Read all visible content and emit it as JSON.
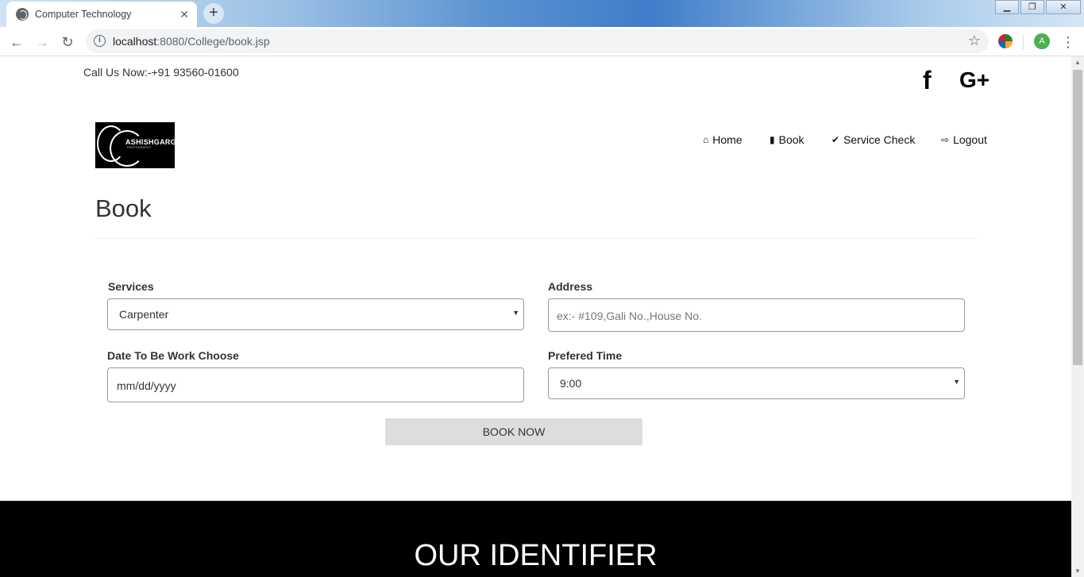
{
  "browser": {
    "tab_title": "Computer Technology",
    "tab_close": "✕",
    "new_tab": "+",
    "url_host": "localhost",
    "url_rest": ":8080/College/book.jsp",
    "avatar_letter": "A",
    "window_buttons": {
      "minimize": "▁",
      "maximize": "❐",
      "close": "✕"
    }
  },
  "topbar": {
    "call_text": "Call Us Now:-+91 93560-01600",
    "facebook": "f",
    "googleplus": "G+"
  },
  "logo": {
    "name": "ASHISHGARG",
    "tagline": "PHOTOGRAPHY"
  },
  "nav": [
    {
      "icon": "home-icon",
      "glyph": "🏠",
      "label": "Home"
    },
    {
      "icon": "file-icon",
      "glyph": "📄",
      "label": "Book"
    },
    {
      "icon": "check-icon",
      "glyph": "✔",
      "label": "Service Check"
    },
    {
      "icon": "logout-icon",
      "glyph": "➜",
      "label": "Logout"
    }
  ],
  "page": {
    "title": "Book"
  },
  "form": {
    "services_label": "Services",
    "services_value": "Carpenter",
    "address_label": "Address",
    "address_placeholder": "ex:- #109,Gali No.,House No.",
    "date_label": "Date To Be Work Choose",
    "date_placeholder": "mm/dd/yyyy",
    "time_label": "Prefered Time",
    "time_value": "9:00",
    "submit": "BOOK NOW"
  },
  "footer": {
    "heading": "OUR IDENTIFIER"
  }
}
